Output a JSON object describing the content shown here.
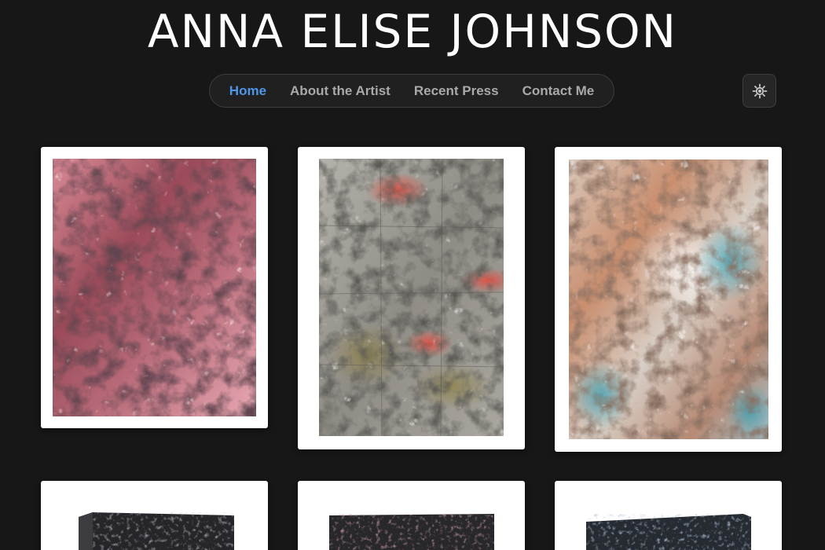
{
  "site": {
    "title": "ANNA ELISE JOHNSON"
  },
  "nav": {
    "items": [
      {
        "label": "Home",
        "active": true
      },
      {
        "label": "About the Artist",
        "active": false
      },
      {
        "label": "Recent Press",
        "active": false
      },
      {
        "label": "Contact Me",
        "active": false
      }
    ],
    "active_color": "#4f95e8",
    "inactive_color": "#a9a9a9"
  },
  "theme_toggle": {
    "icon": "sun-icon"
  },
  "gallery": {
    "artworks": [
      {
        "name": "crumpled-pink-painting",
        "palette": [
          "#7a3a46",
          "#d98a96",
          "#f2cfd3",
          "#2a1c22"
        ]
      },
      {
        "name": "crumpled-silver-painting",
        "palette": [
          "#8d8a83",
          "#c9c7c2",
          "#4a4845",
          "#e05a4e"
        ]
      },
      {
        "name": "crumpled-rainbow-painting",
        "palette": [
          "#c78a6a",
          "#e9e4df",
          "#4aa0b0",
          "#6e4a3c"
        ]
      },
      {
        "name": "stone-sculpture-1",
        "palette": [
          "#2a2a2e",
          "#5a4a52"
        ]
      },
      {
        "name": "stone-sculpture-2",
        "palette": [
          "#2a2a2e",
          "#6a3a48"
        ]
      },
      {
        "name": "stone-sculpture-3",
        "palette": [
          "#2a2e36",
          "#4a6a88"
        ]
      }
    ]
  },
  "colors": {
    "background": "#171717",
    "title": "#ffffff",
    "card": "#ffffff"
  }
}
